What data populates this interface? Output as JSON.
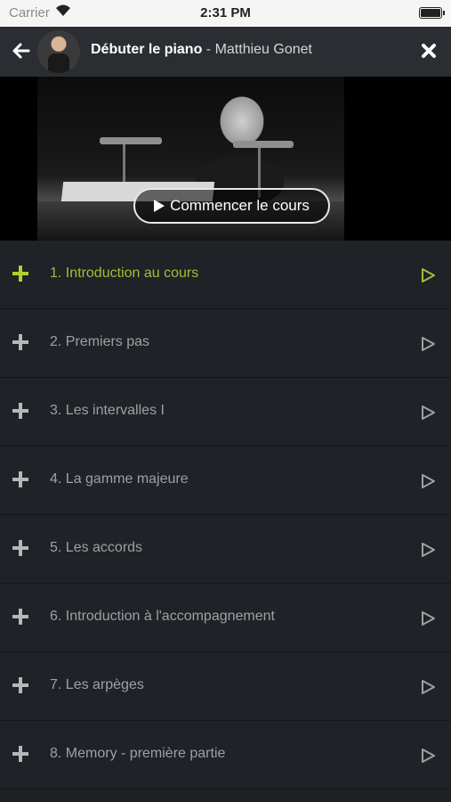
{
  "status_bar": {
    "carrier": "Carrier",
    "time": "2:31 PM"
  },
  "nav": {
    "course_title": "Débuter le piano",
    "author": " - Matthieu Gonet"
  },
  "hero": {
    "start_label": "Commencer le cours"
  },
  "colors": {
    "accent": "#b2cf2b",
    "background": "#1f2226",
    "nav": "#2a2d31"
  },
  "lessons": [
    {
      "label": "1. Introduction au cours",
      "active": true
    },
    {
      "label": "2. Premiers pas",
      "active": false
    },
    {
      "label": "3. Les intervalles I",
      "active": false
    },
    {
      "label": "4. La gamme majeure",
      "active": false
    },
    {
      "label": "5. Les accords",
      "active": false
    },
    {
      "label": "6. Introduction à l'accompagnement",
      "active": false
    },
    {
      "label": "7. Les arpèges",
      "active": false
    },
    {
      "label": "8. Memory - première partie",
      "active": false
    }
  ]
}
